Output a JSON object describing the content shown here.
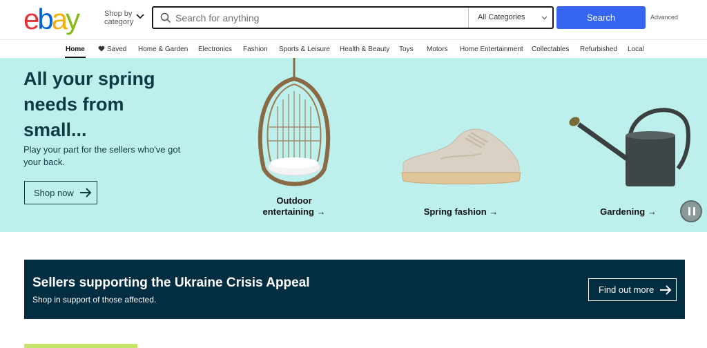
{
  "colors": {
    "accent": "#3665f3",
    "hero_bg": "#bdf0ec",
    "banner_bg": "#032e42",
    "text_dark": "#0e3b43"
  },
  "header": {
    "logo_letters": [
      "e",
      "b",
      "a",
      "y"
    ],
    "logo_colors": [
      "#e53238",
      "#0064d2",
      "#f5af02",
      "#86b817"
    ],
    "shop_by": "Shop by",
    "shop_by_2": "category",
    "search_placeholder": "Search for anything",
    "category_selected": "All Categories",
    "search_button": "Search",
    "advanced": "Advanced"
  },
  "nav": {
    "items": [
      "Home",
      "Saved",
      "Home & Garden",
      "Electronics",
      "Fashion",
      "Sports & Leisure",
      "Health & Beauty",
      "Toys",
      "Motors",
      "Home Entertainment",
      "Collectables",
      "Refurbished",
      "Local"
    ]
  },
  "hero": {
    "title": "All your spring needs from small...",
    "subtitle": "Play your part for the sellers who've got your back.",
    "cta": "Shop now",
    "tiles": [
      {
        "label": "Outdoor entertaining",
        "image": "hanging-chair"
      },
      {
        "label": "Spring fashion",
        "image": "sneaker"
      },
      {
        "label": "Gardening",
        "image": "watering-can"
      }
    ]
  },
  "banner": {
    "title": "Sellers supporting the Ukraine Crisis Appeal",
    "subtitle": "Shop in support of those affected.",
    "cta": "Find out more"
  }
}
